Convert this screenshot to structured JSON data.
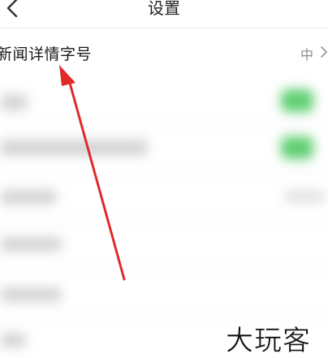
{
  "header": {
    "back_icon": "chevron-left-icon",
    "title": "设置"
  },
  "settings": {
    "font_size_row": {
      "label": "新闻详情字号",
      "value": "中",
      "chevron_icon": "chevron-right-icon"
    }
  },
  "watermark": {
    "text": "大玩客"
  },
  "colors": {
    "toggle_on": "#5fcf72",
    "annotation_arrow": "#e02a2a"
  }
}
